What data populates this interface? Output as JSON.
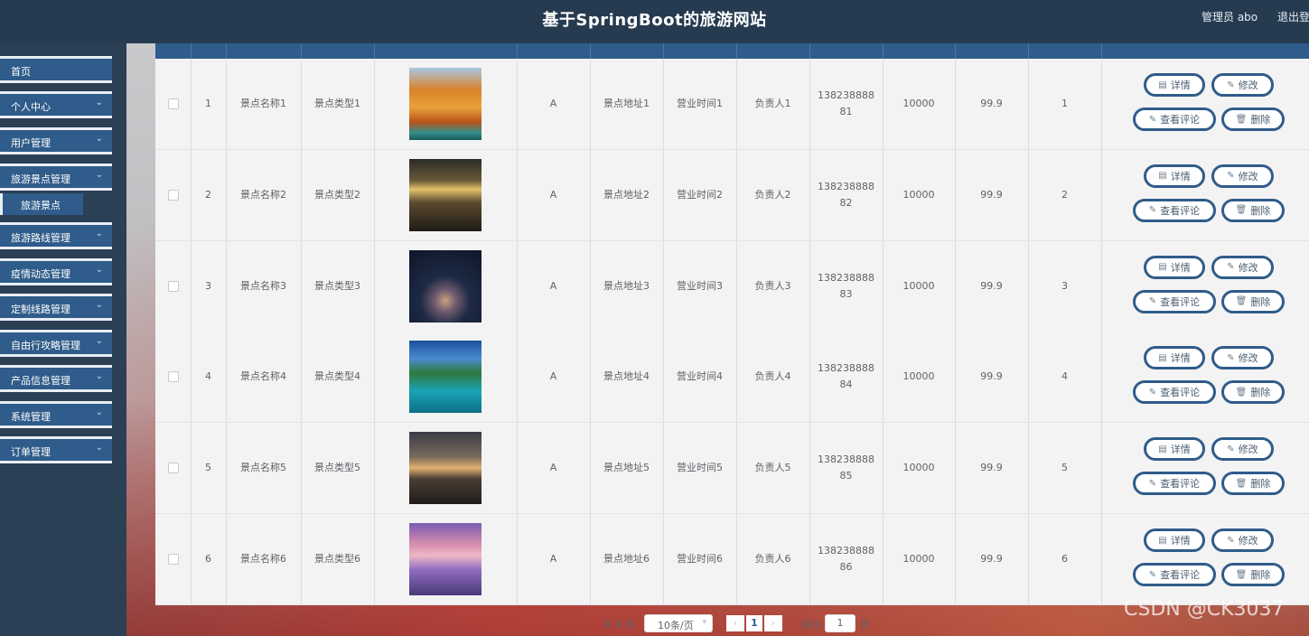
{
  "header": {
    "title": "基于SpringBoot的旅游网站",
    "user": "管理员 abo",
    "logout": "退出登"
  },
  "sidebar": {
    "items": [
      {
        "label": "首页",
        "expandable": false
      },
      {
        "label": "个人中心",
        "expandable": true
      },
      {
        "label": "用户管理",
        "expandable": true
      },
      {
        "label": "旅游景点管理",
        "expandable": true
      },
      {
        "label": "旅游路线管理",
        "expandable": true
      },
      {
        "label": "疫情动态管理",
        "expandable": true
      },
      {
        "label": "定制线路管理",
        "expandable": true
      },
      {
        "label": "自由行攻略管理",
        "expandable": true
      },
      {
        "label": "产品信息管理",
        "expandable": true
      },
      {
        "label": "系统管理",
        "expandable": true
      },
      {
        "label": "订单管理",
        "expandable": true
      }
    ],
    "active_sub": "旅游景点",
    "chevron_icon": "chevron-down-icon"
  },
  "table": {
    "rows": [
      {
        "idx": "1",
        "name": "景点名称1",
        "type": "景点类型1",
        "level": "A",
        "addr": "景点地址1",
        "hours": "营业时间1",
        "owner": "负责人1",
        "phone1": "138238888",
        "phone2": "81",
        "a": "10000",
        "b": "99.9",
        "c": "1",
        "img": "autumn-bridge"
      },
      {
        "idx": "2",
        "name": "景点名称2",
        "type": "景点类型2",
        "level": "A",
        "addr": "景点地址2",
        "hours": "营业时间2",
        "owner": "负责人2",
        "phone1": "138238888",
        "phone2": "82",
        "a": "10000",
        "b": "99.9",
        "c": "2",
        "img": "sunset-beach"
      },
      {
        "idx": "3",
        "name": "景点名称3",
        "type": "景点类型3",
        "level": "A",
        "addr": "景点地址3",
        "hours": "营业时间3",
        "owner": "负责人3",
        "phone1": "138238888",
        "phone2": "83",
        "a": "10000",
        "b": "99.9",
        "c": "3",
        "img": "night-jar"
      },
      {
        "idx": "4",
        "name": "景点名称4",
        "type": "景点类型4",
        "level": "A",
        "addr": "景点地址4",
        "hours": "营业时间4",
        "owner": "负责人4",
        "phone1": "138238888",
        "phone2": "84",
        "a": "10000",
        "b": "99.9",
        "c": "4",
        "img": "island-lagoon"
      },
      {
        "idx": "5",
        "name": "景点名称5",
        "type": "景点类型5",
        "level": "A",
        "addr": "景点地址5",
        "hours": "营业时间5",
        "owner": "负责人5",
        "phone1": "138238888",
        "phone2": "85",
        "a": "10000",
        "b": "99.9",
        "c": "5",
        "img": "lake-tree"
      },
      {
        "idx": "6",
        "name": "景点名称6",
        "type": "景点类型6",
        "level": "A",
        "addr": "景点地址6",
        "hours": "营业时间6",
        "owner": "负责人6",
        "phone1": "138238888",
        "phone2": "86",
        "a": "10000",
        "b": "99.9",
        "c": "6",
        "img": "pink-clouds"
      }
    ],
    "actions": {
      "detail": "详情",
      "edit": "修改",
      "comments": "查看评论",
      "delete": "删除"
    }
  },
  "pager": {
    "total": "共 6 条",
    "page_size": "10条/页",
    "current_page": "1",
    "goto_label": "前往",
    "goto_value": "1",
    "page_suffix": "页"
  },
  "watermark": "CSDN @CK3037",
  "colors": {
    "topbar": "#263b50",
    "sidebar": "#2b3f55",
    "accent": "#2f5c8a"
  }
}
